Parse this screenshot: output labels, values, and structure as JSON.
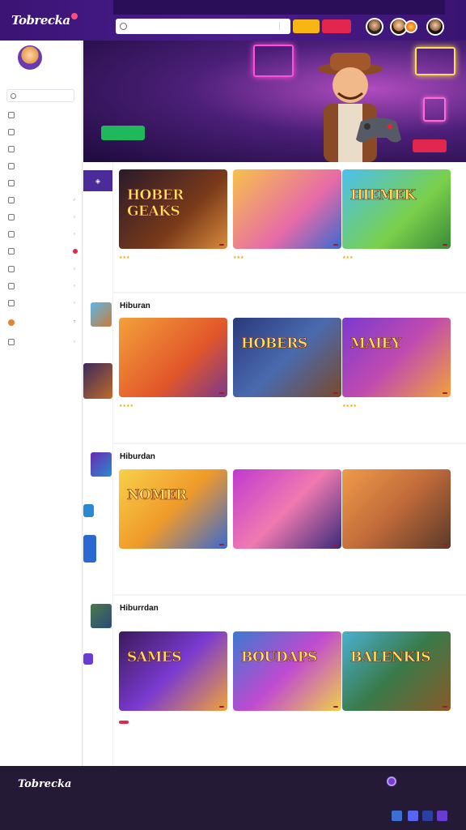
{
  "header": {
    "logo": "Tobrecka",
    "logo_sub": "",
    "topstrip_left": "",
    "topstrip_right": "",
    "search_placeholder": "",
    "btn_yellow": "",
    "btn_red": ""
  },
  "sidebar": {
    "username": "",
    "search_label": "",
    "items": [
      {
        "label": "",
        "right": ""
      },
      {
        "label": "",
        "right": ""
      },
      {
        "label": "",
        "right": ""
      },
      {
        "label": "",
        "right": ""
      },
      {
        "label": "",
        "right": ""
      },
      {
        "label": "",
        "right": "✓"
      },
      {
        "label": "",
        "right": "○"
      },
      {
        "label": "",
        "right": "○"
      },
      {
        "label": "",
        "right": "●"
      },
      {
        "label": "",
        "right": "○"
      },
      {
        "label": "",
        "right": "○"
      },
      {
        "label": "",
        "right": "○"
      },
      {
        "label": "",
        "right": "?"
      },
      {
        "label": "",
        "right": "○"
      }
    ]
  },
  "hero": {
    "kicker": "",
    "title_line1": "",
    "title_line2": "",
    "subtitle": "",
    "small": "",
    "cta": "",
    "cta2": ""
  },
  "sections": [
    {
      "title": "",
      "more": "",
      "cards": [
        {
          "art": "HOBER GEAKS",
          "tag": "",
          "title": "",
          "meta": "",
          "stars": "★★★",
          "foot": ""
        },
        {
          "art": "",
          "tag": "",
          "title": "",
          "meta": "",
          "stars": "★★★",
          "foot": ""
        },
        {
          "art": "HIEMEK",
          "tag": "",
          "title": "",
          "meta": "",
          "stars": "★★★",
          "foot": ""
        }
      ]
    },
    {
      "title": "Hiburan",
      "more": "",
      "cards": [
        {
          "art": "",
          "tag": "",
          "title": "",
          "meta": "",
          "stars": "★★★★",
          "foot": ""
        },
        {
          "art": "HOBERS",
          "tag": "",
          "title": "",
          "meta": "",
          "stars": "",
          "foot": ""
        },
        {
          "art": "MAIEY",
          "tag": "",
          "title": "",
          "meta": "",
          "stars": "★★★★",
          "foot": ""
        }
      ]
    },
    {
      "title": "Hiburdan",
      "more": "",
      "cards": [
        {
          "art": "NOMER",
          "tag": "",
          "title": "",
          "meta": "",
          "stars": "",
          "foot": ""
        },
        {
          "art": "",
          "tag": "",
          "title": "",
          "meta": "",
          "stars": "",
          "foot": ""
        },
        {
          "art": "",
          "tag": "",
          "title": "",
          "meta": "",
          "stars": "",
          "foot": ""
        }
      ]
    },
    {
      "title": "Hiburrdan",
      "sub": "",
      "more": "",
      "cards": [
        {
          "art": "SAMES",
          "tag": "",
          "title": "",
          "meta": "",
          "badge": "",
          "foot": ""
        },
        {
          "art": "BOUDAPS",
          "tag": "",
          "title": "",
          "meta": "",
          "foot": ""
        },
        {
          "art": "BALENKIS",
          "tag": "",
          "title": "",
          "meta": "",
          "foot": ""
        }
      ]
    }
  ],
  "footer": {
    "logo": "Tobrecka",
    "logo_sub": "",
    "col1": [
      "",
      "",
      ""
    ],
    "col2": [
      "",
      "",
      ""
    ],
    "col3": [
      "",
      "",
      ""
    ],
    "col4": [
      "",
      "",
      ""
    ],
    "badge_text": "",
    "copyright": ""
  },
  "colors": {
    "header_bg": "#3b1475",
    "accent_green": "#1fb85a",
    "accent_red": "#e2264d",
    "accent_yellow": "#f7b614",
    "footer_bg": "#241a36"
  }
}
